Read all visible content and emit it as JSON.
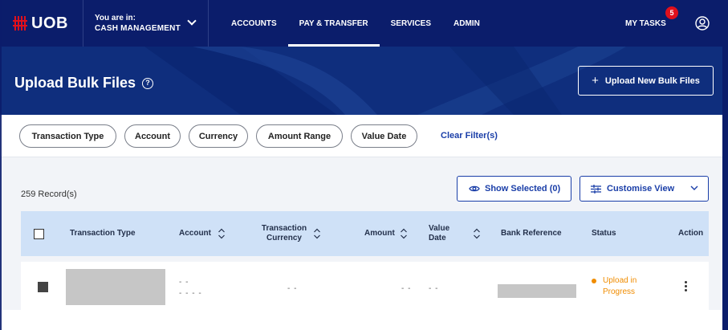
{
  "brand": {
    "name": "UOB"
  },
  "context": {
    "label": "You are in:",
    "value": "CASH MANAGEMENT"
  },
  "nav": {
    "items": [
      {
        "label": "ACCOUNTS",
        "active": false
      },
      {
        "label": "PAY & TRANSFER",
        "active": true
      },
      {
        "label": "SERVICES",
        "active": false
      },
      {
        "label": "ADMIN",
        "active": false
      }
    ],
    "tasks_label": "MY TASKS",
    "tasks_count": "5"
  },
  "page": {
    "title": "Upload Bulk Files",
    "help_icon": "?",
    "upload_button": "Upload New Bulk Files"
  },
  "filters": {
    "chips": [
      "Transaction Type",
      "Account",
      "Currency",
      "Amount Range",
      "Value Date"
    ],
    "clear_label": "Clear Filter(s)"
  },
  "toolbar": {
    "records": "259 Record(s)",
    "show_selected": "Show Selected (0)",
    "customise_view": "Customise View"
  },
  "table": {
    "headers": {
      "transaction_type": "Transaction Type",
      "account": "Account",
      "transaction_currency_1": "Transaction",
      "transaction_currency_2": "Currency",
      "amount": "Amount",
      "value_date_1": "Value",
      "value_date_2": "Date",
      "bank_reference": "Bank Reference",
      "status": "Status",
      "action": "Action"
    },
    "rows": [
      {
        "account_1": "- -",
        "account_2": "- - - -",
        "currency": "- -",
        "amount": "- -",
        "value_date": "- -",
        "status_1": "Upload in",
        "status_2": "Progress"
      }
    ]
  },
  "colors": {
    "nav_bg": "#0b1d6b",
    "banner_bg": "#0f2e7d",
    "brand_red": "#e0101c",
    "link_blue": "#1a3ea8",
    "table_header_bg": "#cfe1f7",
    "status_orange": "#f08c00"
  }
}
